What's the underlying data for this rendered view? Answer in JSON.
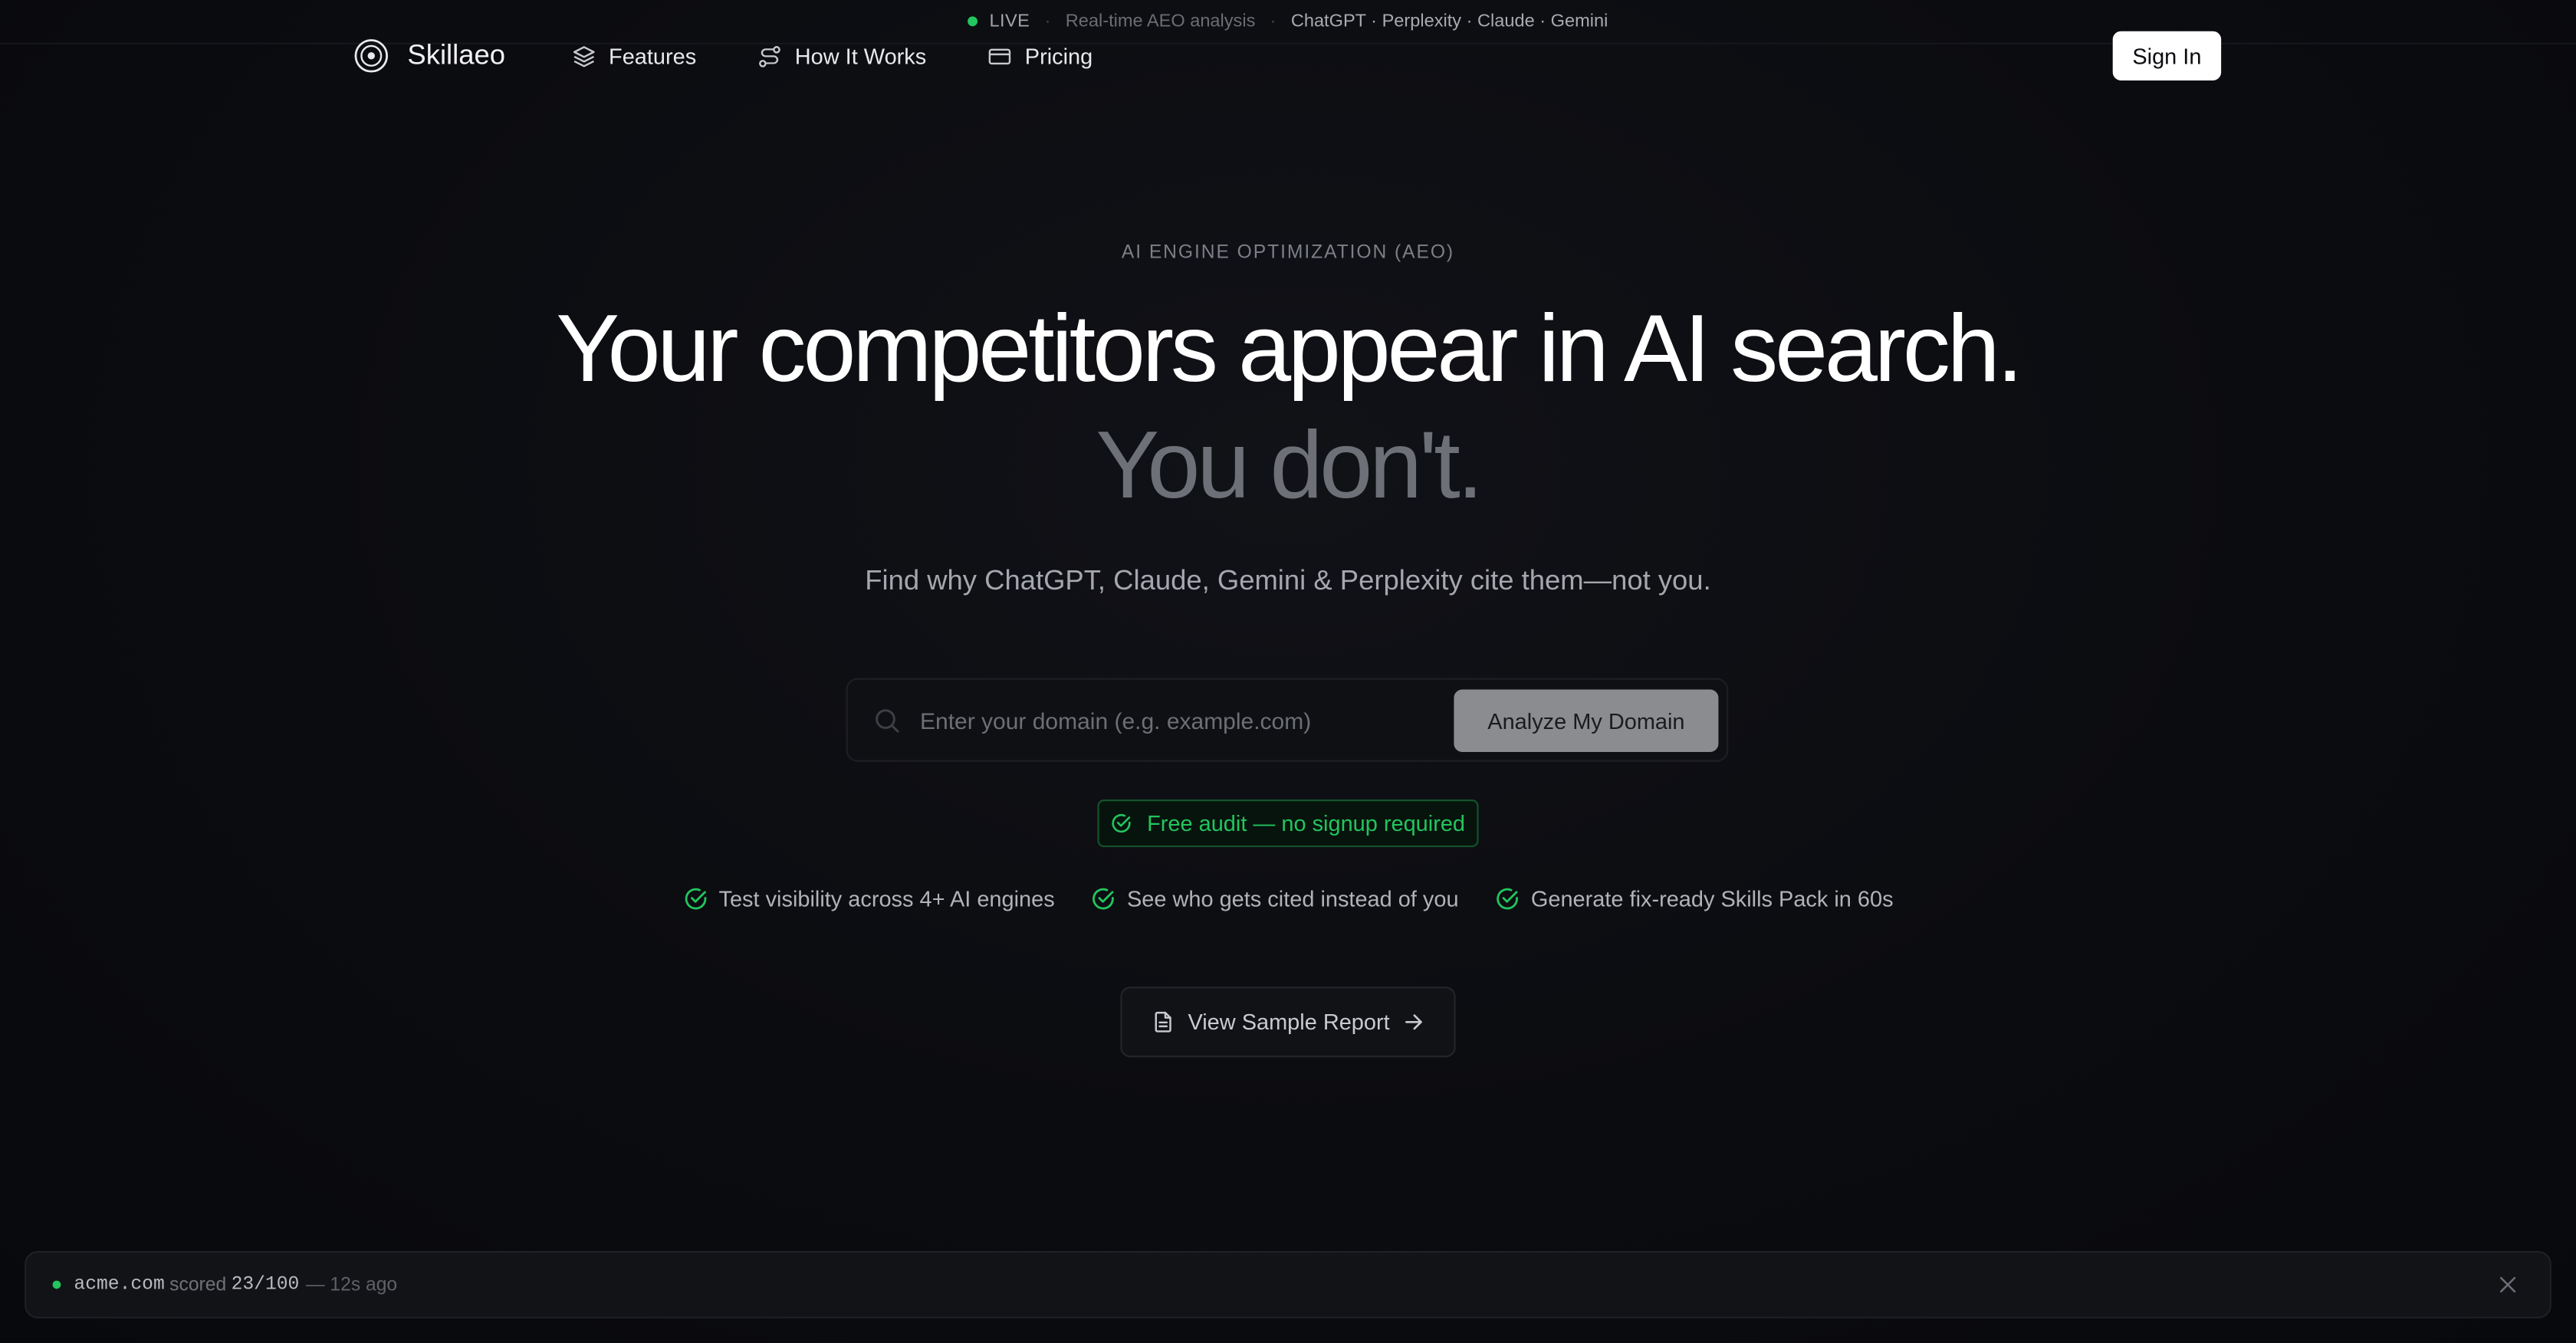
{
  "topbar": {
    "live_label": "LIVE",
    "tagline": "Real-time AEO analysis",
    "engines": "ChatGPT · Perplexity · Claude · Gemini",
    "separator": "·"
  },
  "nav": {
    "brand": "Skillaeo",
    "links": [
      {
        "label": "Features",
        "icon": "layers-icon"
      },
      {
        "label": "How It Works",
        "icon": "route-icon"
      },
      {
        "label": "Pricing",
        "icon": "credit-card-icon"
      }
    ],
    "signin_label": "Sign In"
  },
  "hero": {
    "eyebrow": "AI ENGINE OPTIMIZATION (AEO)",
    "headline_line1": "Your competitors appear in AI search.",
    "headline_line2": "You don't.",
    "subtitle": "Find why ChatGPT, Claude, Gemini & Perplexity cite them—not you."
  },
  "search": {
    "placeholder": "Enter your domain (e.g. example.com)",
    "value": "",
    "button_label": "Analyze My Domain"
  },
  "badge": {
    "label": "Free audit — no signup required"
  },
  "features": [
    {
      "label": "Test visibility across 4+ AI engines"
    },
    {
      "label": "See who gets cited instead of you"
    },
    {
      "label": "Generate fix-ready Skills Pack in 60s"
    }
  ],
  "sample_report": {
    "label": "View Sample Report"
  },
  "toast": {
    "domain": "acme.com",
    "scored_text": "scored",
    "score": "23/100",
    "ago": "— 12s ago"
  },
  "colors": {
    "background": "#0b0c10",
    "accent_green": "#22c55e",
    "button_gray": "#8b8c90",
    "headline_muted": "#6e7077"
  }
}
